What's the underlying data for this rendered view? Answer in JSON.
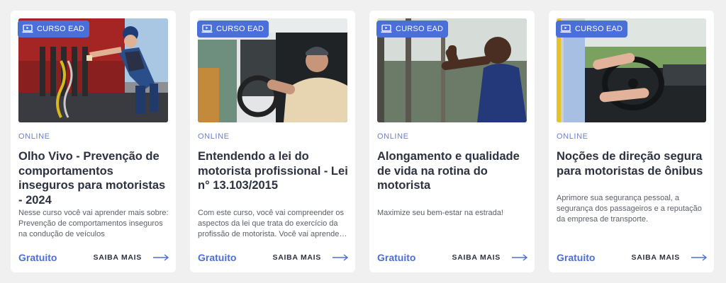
{
  "colors": {
    "accent": "#4a6fd8",
    "title": "#2d3142",
    "mode": "#6f7fd0",
    "background": "#f0f0f1"
  },
  "cards": [
    {
      "badge": "CURSO EAD",
      "badge_icon": "laptop-icon",
      "image": "truck-mechanic-photo",
      "mode": "ONLINE",
      "title": "Olho Vivo - Prevenção de comportamentos inseguros para motoristas - 2024",
      "description": "Nesse curso você vai aprender mais sobre: Prevenção de comportamentos inseguros na condução de veículos",
      "price": "Gratuito",
      "more_label": "SAIBA MAIS",
      "more_icon": "arrow-right-icon"
    },
    {
      "badge": "CURSO EAD",
      "badge_icon": "laptop-icon",
      "image": "truck-driver-photo",
      "mode": "ONLINE",
      "title": "Entendendo a lei do motorista profissional - Lei n° 13.103/2015",
      "description": "Com este curso, você vai compreender os aspectos da lei que trata do exercício da profissão de motorista. Você vai aprender sobre os direitos e deveres do motorista profissional.",
      "price": "Gratuito",
      "more_label": "SAIBA MAIS",
      "more_icon": "arrow-right-icon"
    },
    {
      "badge": "CURSO EAD",
      "badge_icon": "laptop-icon",
      "image": "stretching-man-photo",
      "mode": "ONLINE",
      "title": "Alongamento e qualidade de vida na rotina do motorista",
      "description": "Maximize seu bem-estar na estrada!",
      "price": "Gratuito",
      "more_label": "SAIBA MAIS",
      "more_icon": "arrow-right-icon"
    },
    {
      "badge": "CURSO EAD",
      "badge_icon": "laptop-icon",
      "image": "bus-driver-photo",
      "mode": "ONLINE",
      "title": "Noções de direção segura para motoristas de ônibus",
      "description": "Aprimore sua segurança pessoal, a segurança dos passageiros e a reputação da empresa de transporte.",
      "price": "Gratuito",
      "more_label": "SAIBA MAIS",
      "more_icon": "arrow-right-icon"
    }
  ]
}
